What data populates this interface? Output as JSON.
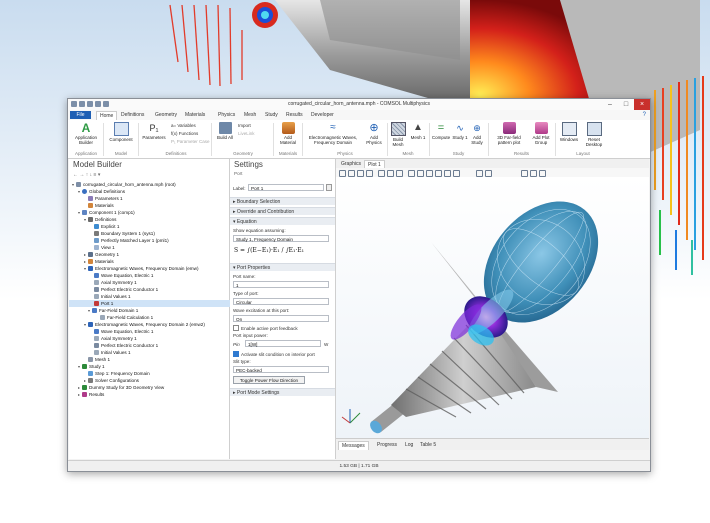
{
  "window": {
    "title": "corrugated_circular_horn_antenna.mph - COMSOL Multiphysics"
  },
  "tabs": [
    "File",
    "Home",
    "Definitions",
    "Geometry",
    "Materials",
    "Physics",
    "Mesh",
    "Study",
    "Results",
    "Developer"
  ],
  "ribbon": {
    "app_builder": "Application Builder",
    "component": "Component",
    "parameters": "Parameters",
    "variables": "a= Variables",
    "functions": "f(x) Functions",
    "parameter_case": "P₁ Parameter Case",
    "build_all": "Build All",
    "import": "Import",
    "livelink": "LiveLink",
    "add_material": "Add Material",
    "physics": "Electromagnetic Waves, Frequency Domain",
    "add_physics": "Add Physics",
    "build_mesh": "Build Mesh",
    "mesh1": "Mesh 1",
    "compute": "Compute",
    "study1": "Study 1",
    "add_study": "Add Study",
    "farfield": "3D Far-field pattern plot",
    "add_plot": "Add Plot Group",
    "windows": "Windows",
    "reset": "Reset Desktop",
    "groups": [
      "Application",
      "Model",
      "Definitions",
      "Geometry",
      "Materials",
      "Physics",
      "Mesh",
      "Study",
      "Results",
      "Layout"
    ]
  },
  "model_builder": {
    "title": "Model Builder",
    "rows": [
      "corrugated_circular_horn_antenna.mph (root)",
      "Global Definitions",
      "Parameters 1",
      "Materials",
      "Component 1 (comp1)",
      "Definitions",
      "Explicit 1",
      "Boundary System 1 (sys1)",
      "Perfectly Matched Layer 1 (pml1)",
      "View 1",
      "Geometry 1",
      "Materials",
      "Electromagnetic Waves, Frequency Domain (emw)",
      "Wave Equation, Electric 1",
      "Axial Symmetry 1",
      "Perfect Electric Conductor 1",
      "Initial Values 1",
      "Port 1",
      "Far-Field Domain 1",
      "Far-Field Calculation 1",
      "Electromagnetic Waves, Frequency Domain 2 (emw2)",
      "Wave Equation, Electric 1",
      "Axial Symmetry 1",
      "Perfect Electric Conductor 1",
      "Initial Values 1",
      "Mesh 1",
      "Study 1",
      "Step 1: Frequency Domain",
      "Solver Configurations",
      "Dummy Study for 3D Geometry View",
      "Results"
    ]
  },
  "settings": {
    "title": "Settings",
    "subtitle": "Port",
    "label_caption": "Label:",
    "label_value": "Port 1",
    "sections": [
      "Boundary Selection",
      "Override and Contribution",
      "Equation",
      "Port Properties",
      "Port Mode Settings"
    ],
    "show_eq": "Show equation assuming:",
    "eq_study": "Study 1, Frequency Domain",
    "port_name_label": "Port name:",
    "port_name_value": "1",
    "type_label": "Type of port:",
    "type_value": "Circular",
    "wave_label": "Wave excitation at this port:",
    "wave_value": "On",
    "active_feedback": "Enable active port feedback",
    "input_power_label": "Port input power:",
    "pin_symbol": "Pin",
    "pin_value": "1[W]",
    "pin_unit": "W",
    "slit_check": "Activate slit condition on interior port",
    "slit_type_label": "Slit type:",
    "slit_type_value": "PEC-backed",
    "toggle_btn": "Toggle Power Flow Direction"
  },
  "graphics": {
    "tabs": [
      "Graphics",
      "Plot 1"
    ]
  },
  "messages": {
    "tabs": [
      "Messages",
      "Progress",
      "Log",
      "Table 5"
    ]
  },
  "status": {
    "memory": "1.53 GB | 1.71 GB"
  },
  "colors": {
    "accent": "#1e5fb4",
    "selection": "#cfe3f7"
  }
}
